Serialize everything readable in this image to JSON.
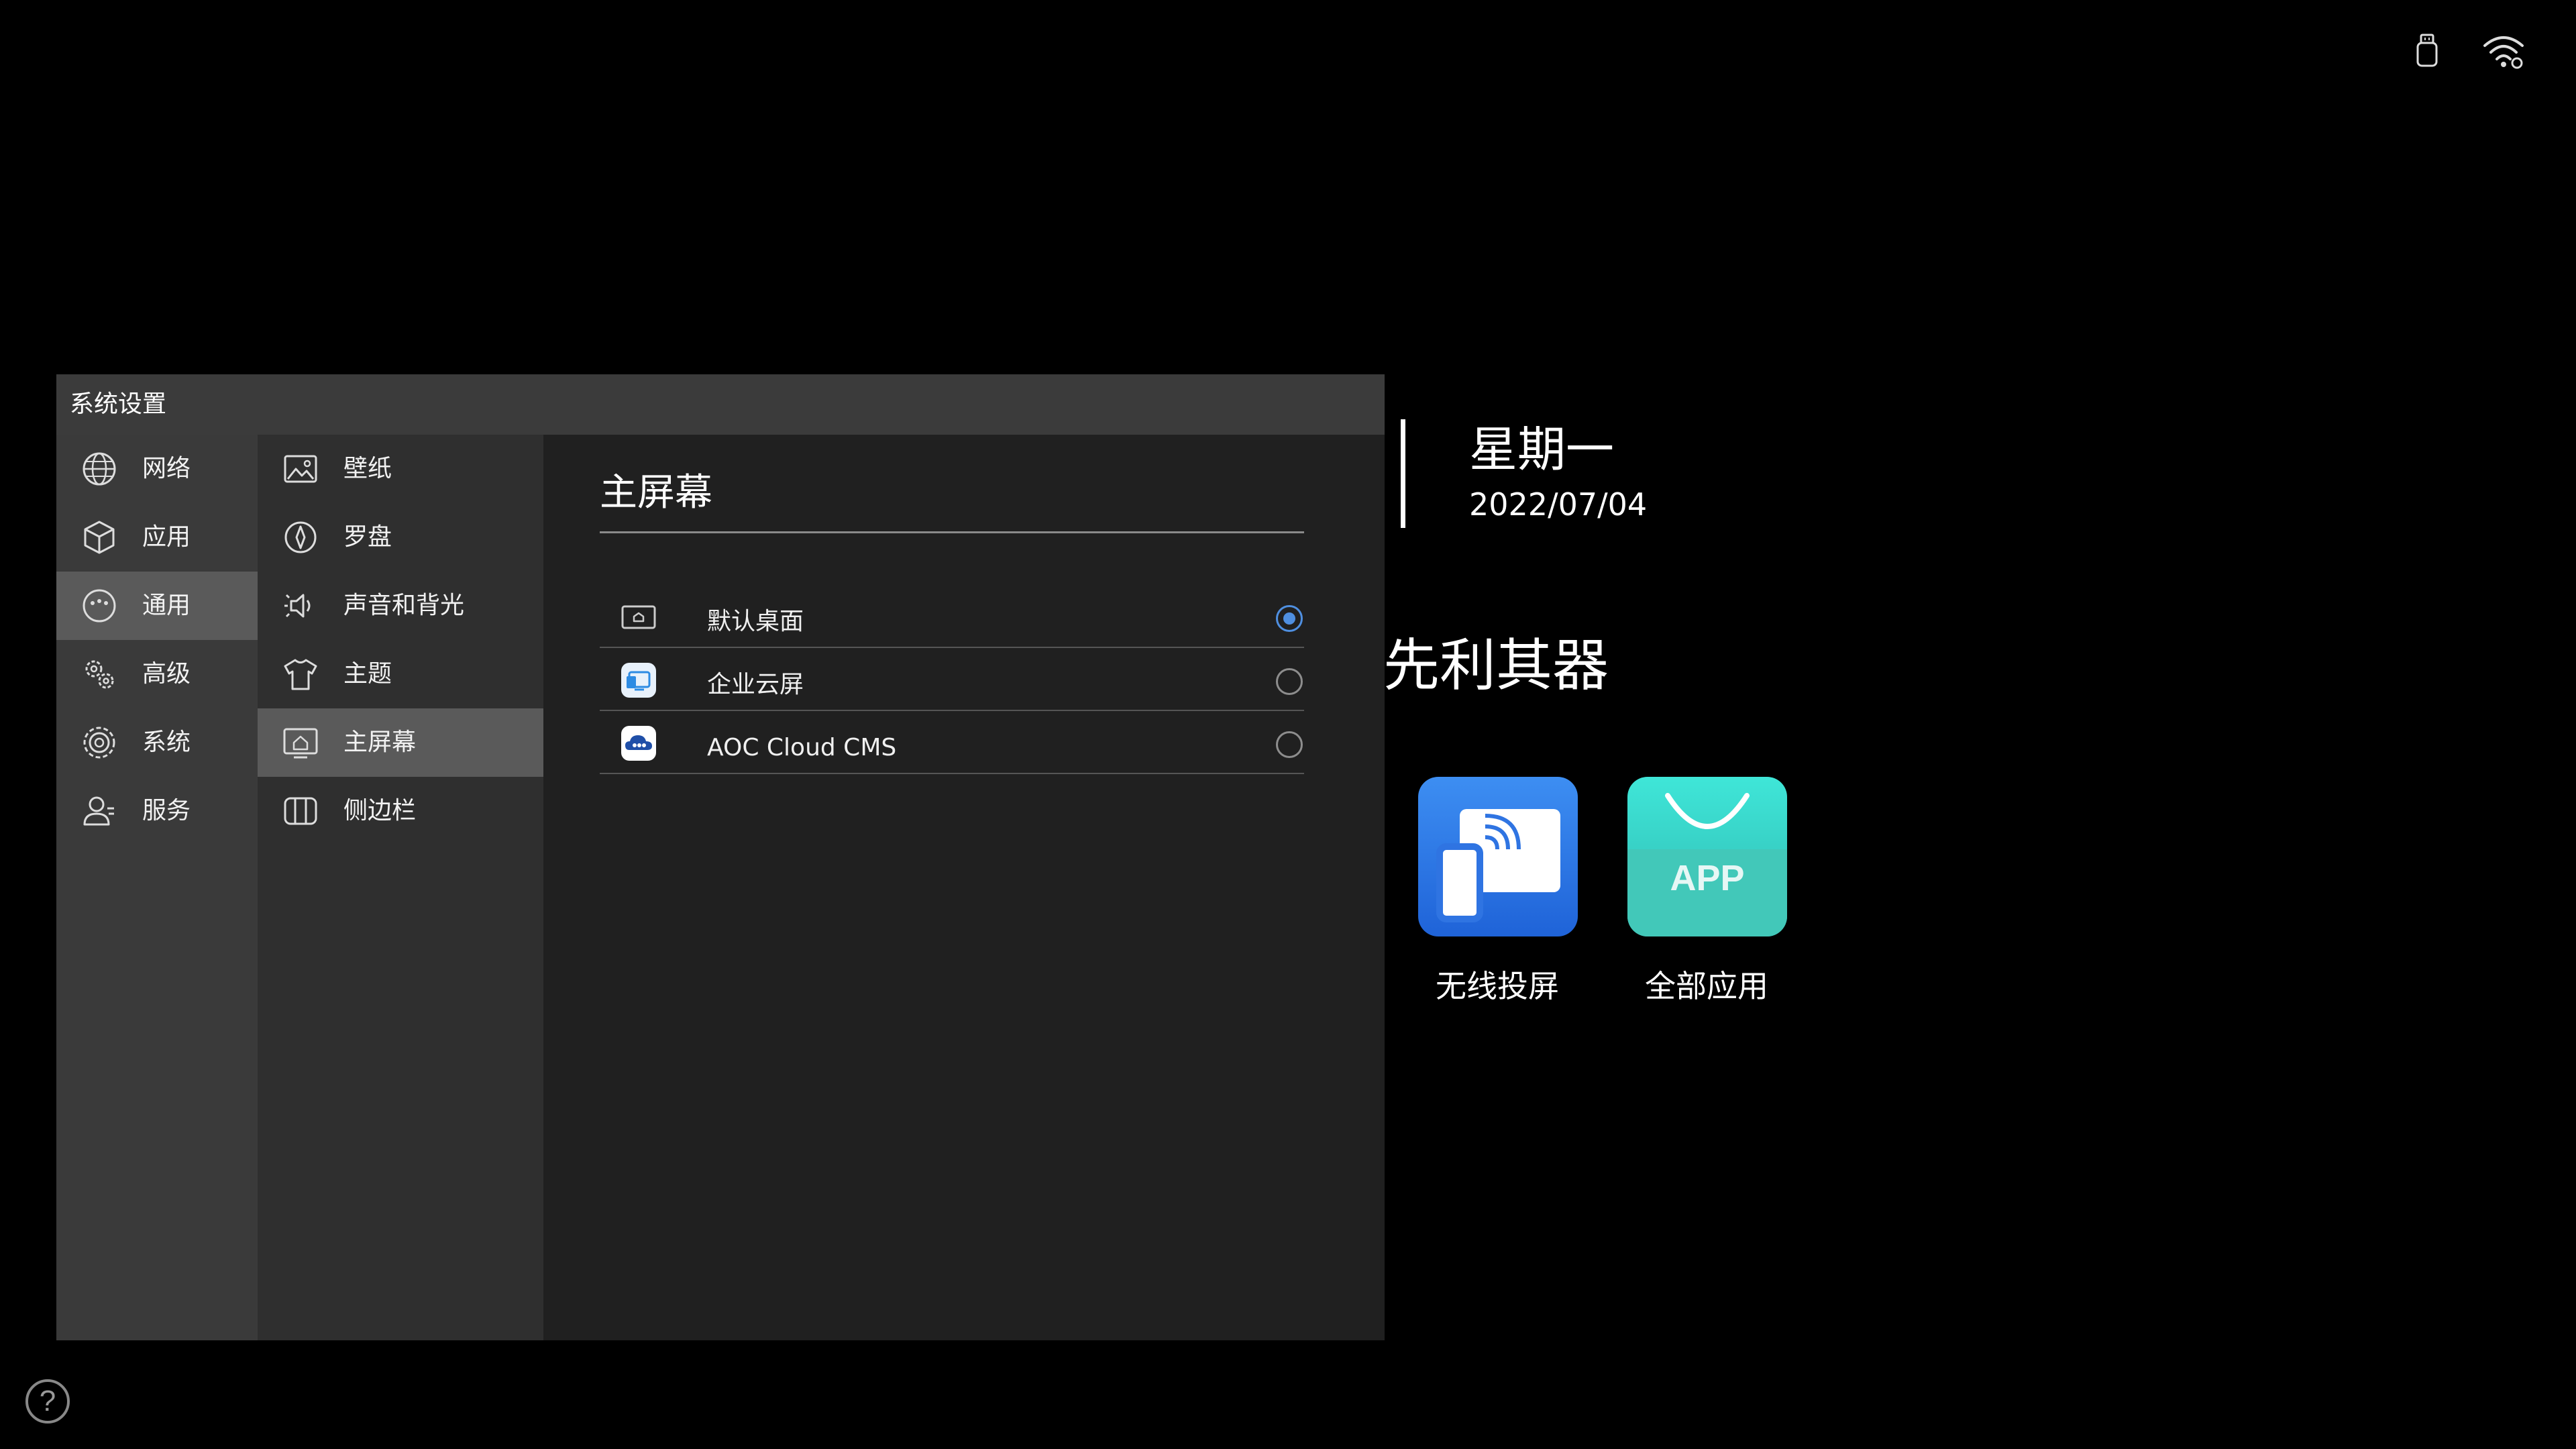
{
  "status_bar": {
    "usb_icon": "usb-icon",
    "wifi_icon": "wifi-icon"
  },
  "launcher": {
    "weekday": "星期一",
    "date": "2022/07/04",
    "slogan": "先利其器",
    "apps": [
      {
        "label": "无线投屏",
        "icon": "wireless-cast-icon",
        "color": "#2f7be8"
      },
      {
        "label": "全部应用",
        "icon": "app-store-icon",
        "badge": "APP",
        "color": "#35cfc5"
      }
    ],
    "help_icon": "help-icon",
    "help_glyph": "?"
  },
  "settings": {
    "title": "系统设置",
    "categories": [
      {
        "label": "网络",
        "icon": "globe-icon"
      },
      {
        "label": "应用",
        "icon": "cube-icon"
      },
      {
        "label": "通用",
        "icon": "general-icon",
        "selected": true
      },
      {
        "label": "高级",
        "icon": "gears-icon"
      },
      {
        "label": "系统",
        "icon": "gear-icon"
      },
      {
        "label": "服务",
        "icon": "user-icon"
      }
    ],
    "subcategories": [
      {
        "label": "壁纸",
        "icon": "wallpaper-icon"
      },
      {
        "label": "罗盘",
        "icon": "compass-icon"
      },
      {
        "label": "声音和背光",
        "icon": "sound-icon"
      },
      {
        "label": "主题",
        "icon": "shirt-icon"
      },
      {
        "label": "主屏幕",
        "icon": "home-screen-icon",
        "selected": true
      },
      {
        "label": "侧边栏",
        "icon": "sidebar-icon"
      }
    ],
    "section_title": "主屏幕",
    "options": [
      {
        "label": "默认桌面",
        "icon": "desktop-icon",
        "checked": true
      },
      {
        "label": "企业云屏",
        "icon": "cloud-screen-icon",
        "checked": false
      },
      {
        "label": "AOC Cloud CMS",
        "icon": "aoc-cloud-icon",
        "checked": false
      }
    ],
    "accent_color": "#4f8fe0"
  }
}
